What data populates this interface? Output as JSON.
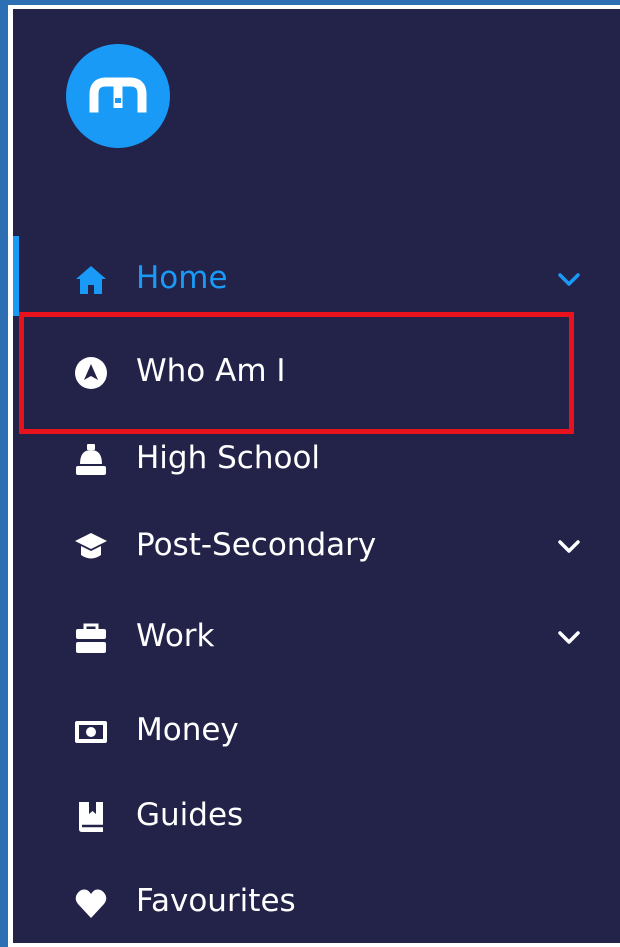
{
  "colors": {
    "sidebar_bg": "#23234a",
    "accent": "#1a9af7",
    "text": "#ffffff",
    "highlight": "#e8121c",
    "frame": "#2d6fb3"
  },
  "logo": {
    "icon": "m-logo-icon"
  },
  "nav": {
    "items": [
      {
        "label": "Home",
        "icon": "home-icon",
        "active": true,
        "has_dropdown": true
      },
      {
        "label": "Who Am I",
        "icon": "compass-icon",
        "active": false,
        "has_dropdown": false,
        "highlighted": true
      },
      {
        "label": "High School",
        "icon": "school-bell-icon",
        "active": false,
        "has_dropdown": false
      },
      {
        "label": "Post-Secondary",
        "icon": "graduation-cap-icon",
        "active": false,
        "has_dropdown": true
      },
      {
        "label": "Work",
        "icon": "briefcase-icon",
        "active": false,
        "has_dropdown": true
      },
      {
        "label": "Money",
        "icon": "money-icon",
        "active": false,
        "has_dropdown": false
      },
      {
        "label": "Guides",
        "icon": "book-icon",
        "active": false,
        "has_dropdown": false
      },
      {
        "label": "Favourites",
        "icon": "heart-icon",
        "active": false,
        "has_dropdown": false
      }
    ]
  }
}
